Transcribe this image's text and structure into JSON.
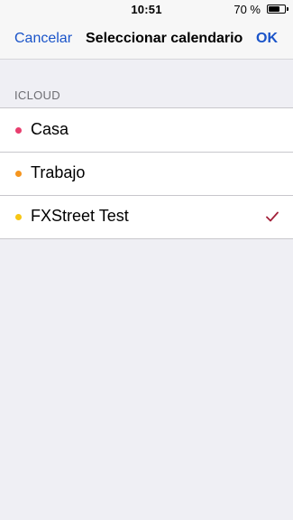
{
  "status_bar": {
    "time": "10:51",
    "battery_percent": "70 %",
    "battery_level": 0.7
  },
  "nav": {
    "cancel_label": "Cancelar",
    "title": "Seleccionar calendario",
    "ok_label": "OK"
  },
  "section": {
    "header": "ICLOUD"
  },
  "calendars": [
    {
      "label": "Casa",
      "color": "#e83e6e",
      "selected": false
    },
    {
      "label": "Trabajo",
      "color": "#f5951f",
      "selected": false
    },
    {
      "label": "FXStreet Test",
      "color": "#f7c615",
      "selected": true
    }
  ],
  "colors": {
    "accent": "#1a54c9",
    "checkmark": "#a3213a"
  },
  "icons": {
    "selected": "checkmark-icon"
  }
}
